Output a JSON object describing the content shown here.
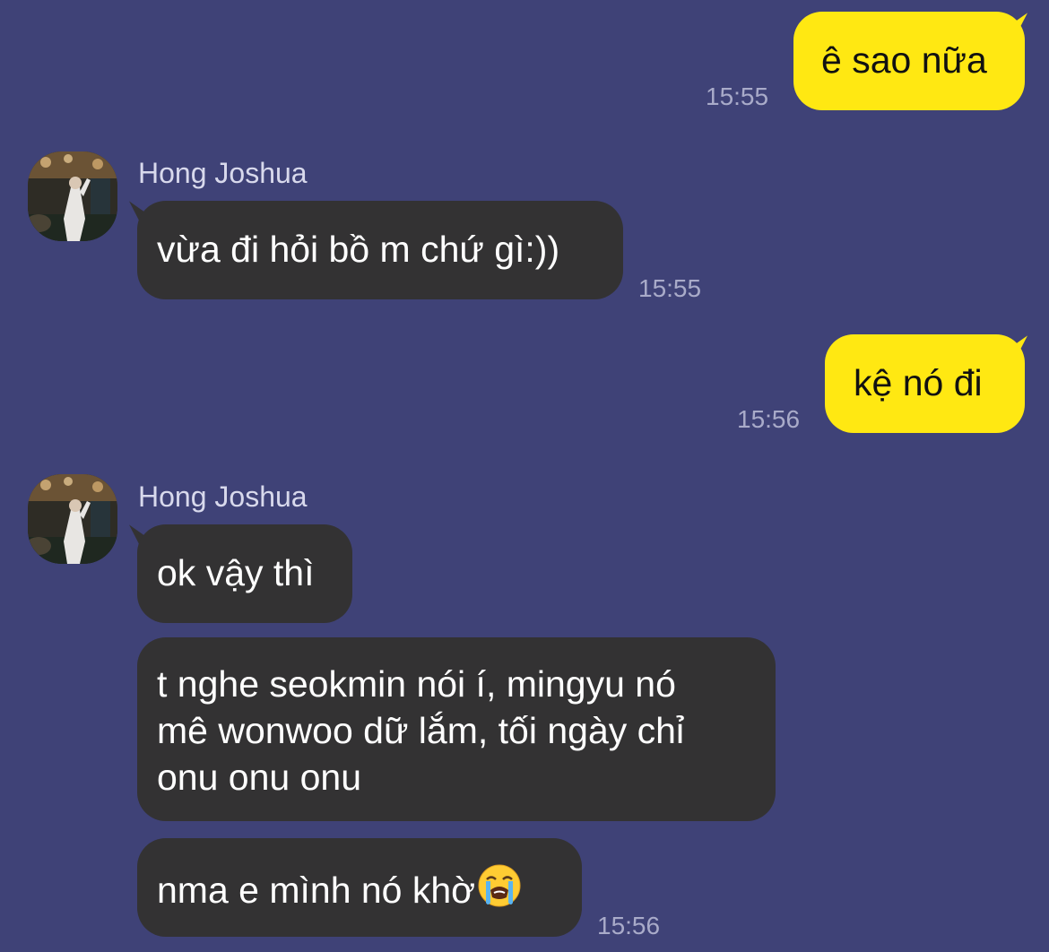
{
  "conversation": {
    "messages": [
      {
        "direction": "outgoing",
        "text": "ê sao nữa",
        "time": "15:55"
      },
      {
        "direction": "incoming",
        "sender": "Hong Joshua",
        "text": "vừa đi hỏi bồ m chứ gì:))",
        "time": "15:55"
      },
      {
        "direction": "outgoing",
        "text": "kệ nó đi",
        "time": "15:56"
      },
      {
        "direction": "incoming",
        "sender": "Hong Joshua",
        "text": "ok vậy thì"
      },
      {
        "direction": "incoming",
        "lines": [
          "t nghe seokmin nói í, mingyu nó",
          "mê wonwoo dữ lắm, tối ngày chỉ",
          "onu onu onu"
        ]
      },
      {
        "direction": "incoming",
        "text": "nma e mình nó khờ",
        "emoji": "loudly-crying-face-emoji",
        "time": "15:56"
      }
    ]
  },
  "colors": {
    "background": "#3f4277",
    "outgoing_bubble": "#ffe812",
    "incoming_bubble": "#333233",
    "timestamp": "#a9abc9"
  }
}
